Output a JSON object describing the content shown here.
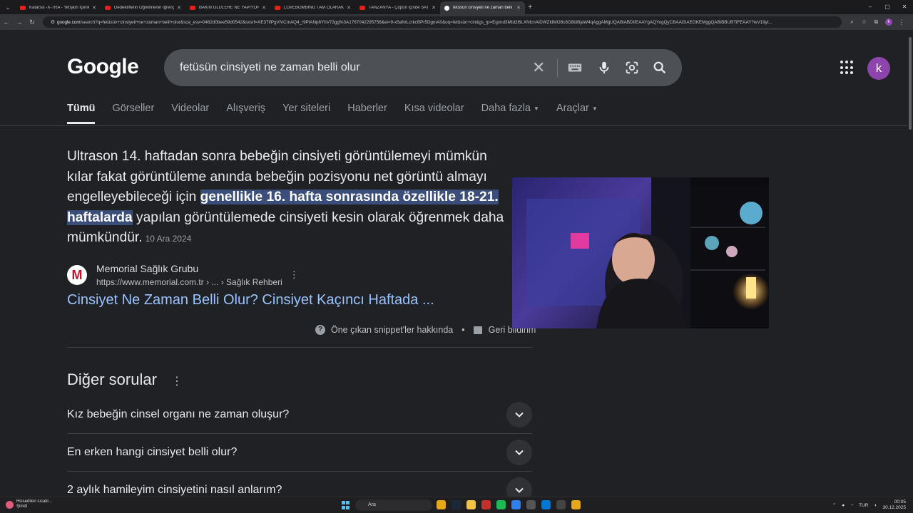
{
  "browser": {
    "tabs": [
      {
        "label": "Katarsis -X-TRA - Yetişkin İçerik",
        "favicon": "youtube-icon",
        "active": false
      },
      {
        "label": "Dedektiflerin Öğretmenin İğrenç",
        "favicon": "youtube-icon",
        "active": false
      },
      {
        "label": "BAKIN ÖLÜLERE NE YAPIYORLAR",
        "favicon": "youtube-icon",
        "active": false
      },
      {
        "label": "LOVEBOMBING TAM OLARAK",
        "favicon": "youtube-icon",
        "active": false
      },
      {
        "label": "TANZANYA - Çöpün İçinde SAT",
        "favicon": "youtube-icon",
        "active": false
      },
      {
        "label": "fetüsün cinsiyeti ne zaman belli",
        "favicon": "google-icon",
        "active": true
      }
    ],
    "url_host": "google.com",
    "url_path": "/search?q=fetüsün+cinsiyeti+ne+zaman+belli+olur&sca_esv=0462d0bee59d0542&sxsrf=AE3TifPgViVCmAQ4_r9PiANp6YhV73gg%3A1767042295756&ei=9-x5afvtLcrkcBPr5DgmA0&oq=fetüsün+cin&gs_lp=Egxnd3Mtd2l6LXNlcnAiDWZldMO8c8O8biBjaW4qAggAMgUQABiABDIIEAAYgAQYogQyCBAAGIAEGKEMggQABiBBUBTiFEAAY?wV19yt...",
    "profile_initial": "k"
  },
  "google": {
    "logo_text": "Google",
    "query": "fetüsün cinsiyeti ne zaman belli olur",
    "avatar_initial": "k",
    "tabs": [
      {
        "label": "Tümü",
        "selected": true,
        "dropdown": false
      },
      {
        "label": "Görseller",
        "selected": false,
        "dropdown": false
      },
      {
        "label": "Videolar",
        "selected": false,
        "dropdown": false
      },
      {
        "label": "Alışveriş",
        "selected": false,
        "dropdown": false
      },
      {
        "label": "Yer siteleri",
        "selected": false,
        "dropdown": false
      },
      {
        "label": "Haberler",
        "selected": false,
        "dropdown": false
      },
      {
        "label": "Kısa videolar",
        "selected": false,
        "dropdown": false
      },
      {
        "label": "Daha fazla",
        "selected": false,
        "dropdown": true
      },
      {
        "label": "Araçlar",
        "selected": false,
        "dropdown": true
      }
    ]
  },
  "snippet": {
    "text_before": "Ultrason 14. haftadan sonra bebeğin cinsiyeti görüntülemeyi mümkün kılar fakat görüntüleme anında bebeğin pozisyonu net görüntü almayı engelleyebileceği için ",
    "highlight": "genellikle 16. hafta sonrasında özellikle 18-21. haftalarda",
    "text_after": " yapılan görüntülemede cinsiyeti kesin olarak öğrenmek daha mümkündür.",
    "date": "10 Ara 2024",
    "source_name": "Memorial Sağlık Grubu",
    "source_url": "https://www.memorial.com.tr › ... › Sağlık Rehberi",
    "source_favicon_letter": "M",
    "link_title": "Cinsiyet Ne Zaman Belli Olur? Cinsiyet Kaçıncı Haftada ...",
    "about_label": "Öne çıkan snippet'ler hakkında",
    "feedback_label": "Geri bildirim"
  },
  "paa": {
    "title": "Diğer sorular",
    "questions": [
      "Kız bebeğin cinsel organı ne zaman oluşur?",
      "En erken hangi cinsiyet belli olur?",
      "2 aylık hamileyim cinsiyetini nasıl anlarım?"
    ]
  },
  "taskbar": {
    "weather_line1": "Hissedilen sıcakl...",
    "weather_line2": "Şimdi",
    "search_placeholder": "Ara",
    "lang": "TUR",
    "time": "00:05",
    "date": "30.12.2025"
  },
  "colors": {
    "page_bg": "#202124",
    "searchbox_bg": "#4d5156",
    "link": "#99c3ff",
    "highlight_bg": "#3b4e7a",
    "avatar": "#8e44ad"
  }
}
